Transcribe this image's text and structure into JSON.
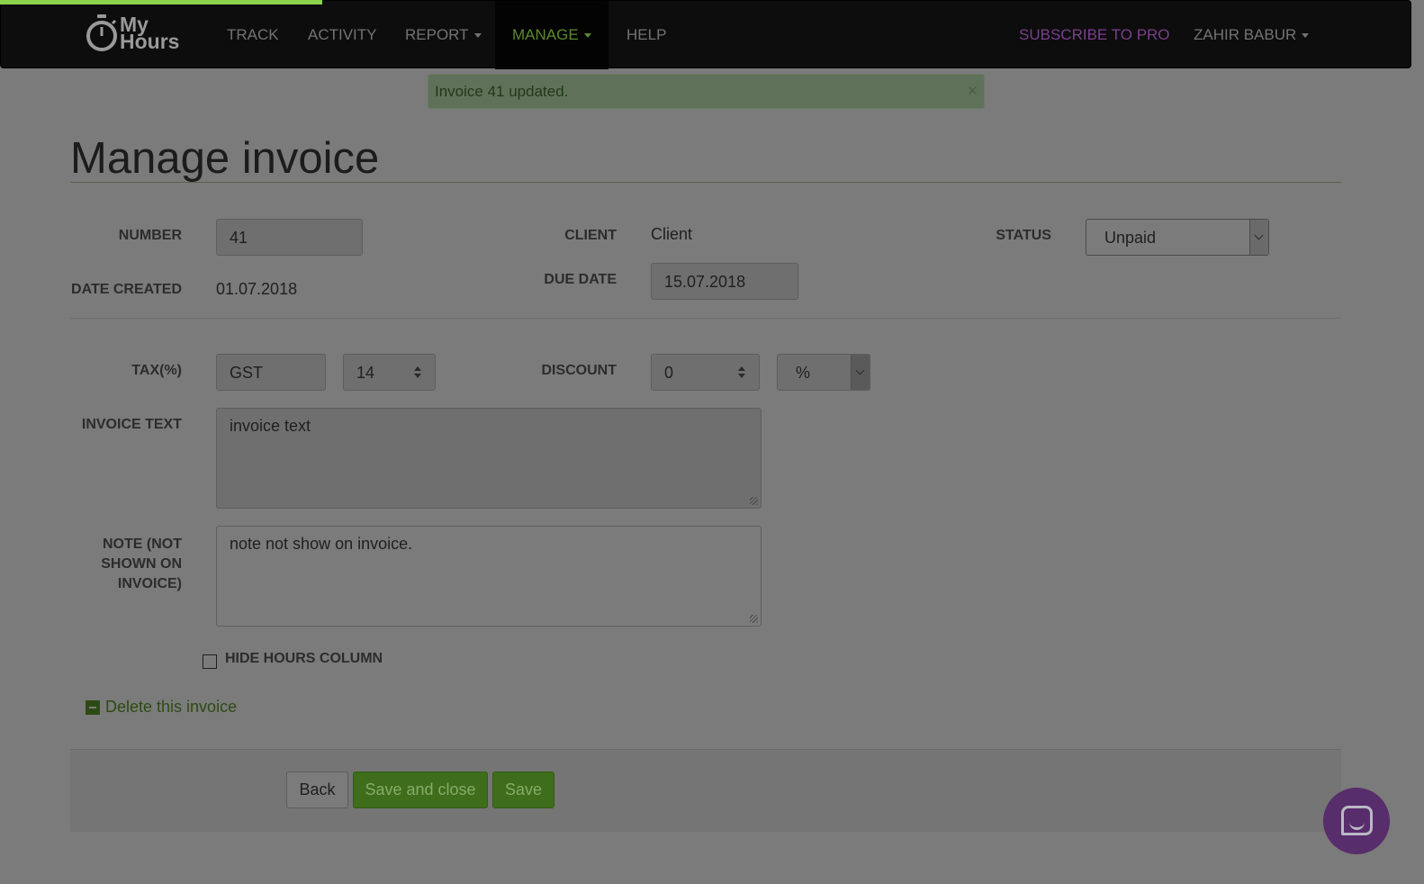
{
  "app": {
    "logo_line1": "My",
    "logo_line2": "Hours"
  },
  "nav": {
    "items": [
      {
        "label": "TRACK"
      },
      {
        "label": "ACTIVITY"
      },
      {
        "label": "REPORT"
      },
      {
        "label": "MANAGE"
      },
      {
        "label": "HELP"
      }
    ],
    "subscribe": "SUBSCRIBE TO PRO",
    "user": "ZAHIR BABUR"
  },
  "alert": {
    "message": "Invoice 41 updated.",
    "close": "×"
  },
  "page": {
    "title": "Manage invoice"
  },
  "form": {
    "number_label": "NUMBER",
    "number_value": "41",
    "client_label": "CLIENT",
    "client_value": "Client",
    "status_label": "STATUS",
    "status_value": "Unpaid",
    "date_created_label": "DATE CREATED",
    "date_created_value": "01.07.2018",
    "due_date_label": "DUE DATE",
    "due_date_value": "15.07.2018",
    "tax_label": "TAX(%)",
    "tax_name": "GST",
    "tax_value": "14",
    "discount_label": "DISCOUNT",
    "discount_value": "0",
    "discount_type": "%",
    "invoice_text_label": "INVOICE TEXT",
    "invoice_text_value": "invoice text",
    "note_label": "NOTE (NOT SHOWN ON INVOICE)",
    "note_value": "note not show on invoice.",
    "hide_hours_label": "HIDE HOURS COLUMN",
    "hide_hours_checked": false,
    "delete_label": "Delete this invoice"
  },
  "buttons": {
    "back": "Back",
    "save_close": "Save and close",
    "save": "Save"
  },
  "colors": {
    "accent_green": "#8bd34b",
    "pro_purple": "#7a3f8c",
    "chat_purple": "#582d6b"
  }
}
